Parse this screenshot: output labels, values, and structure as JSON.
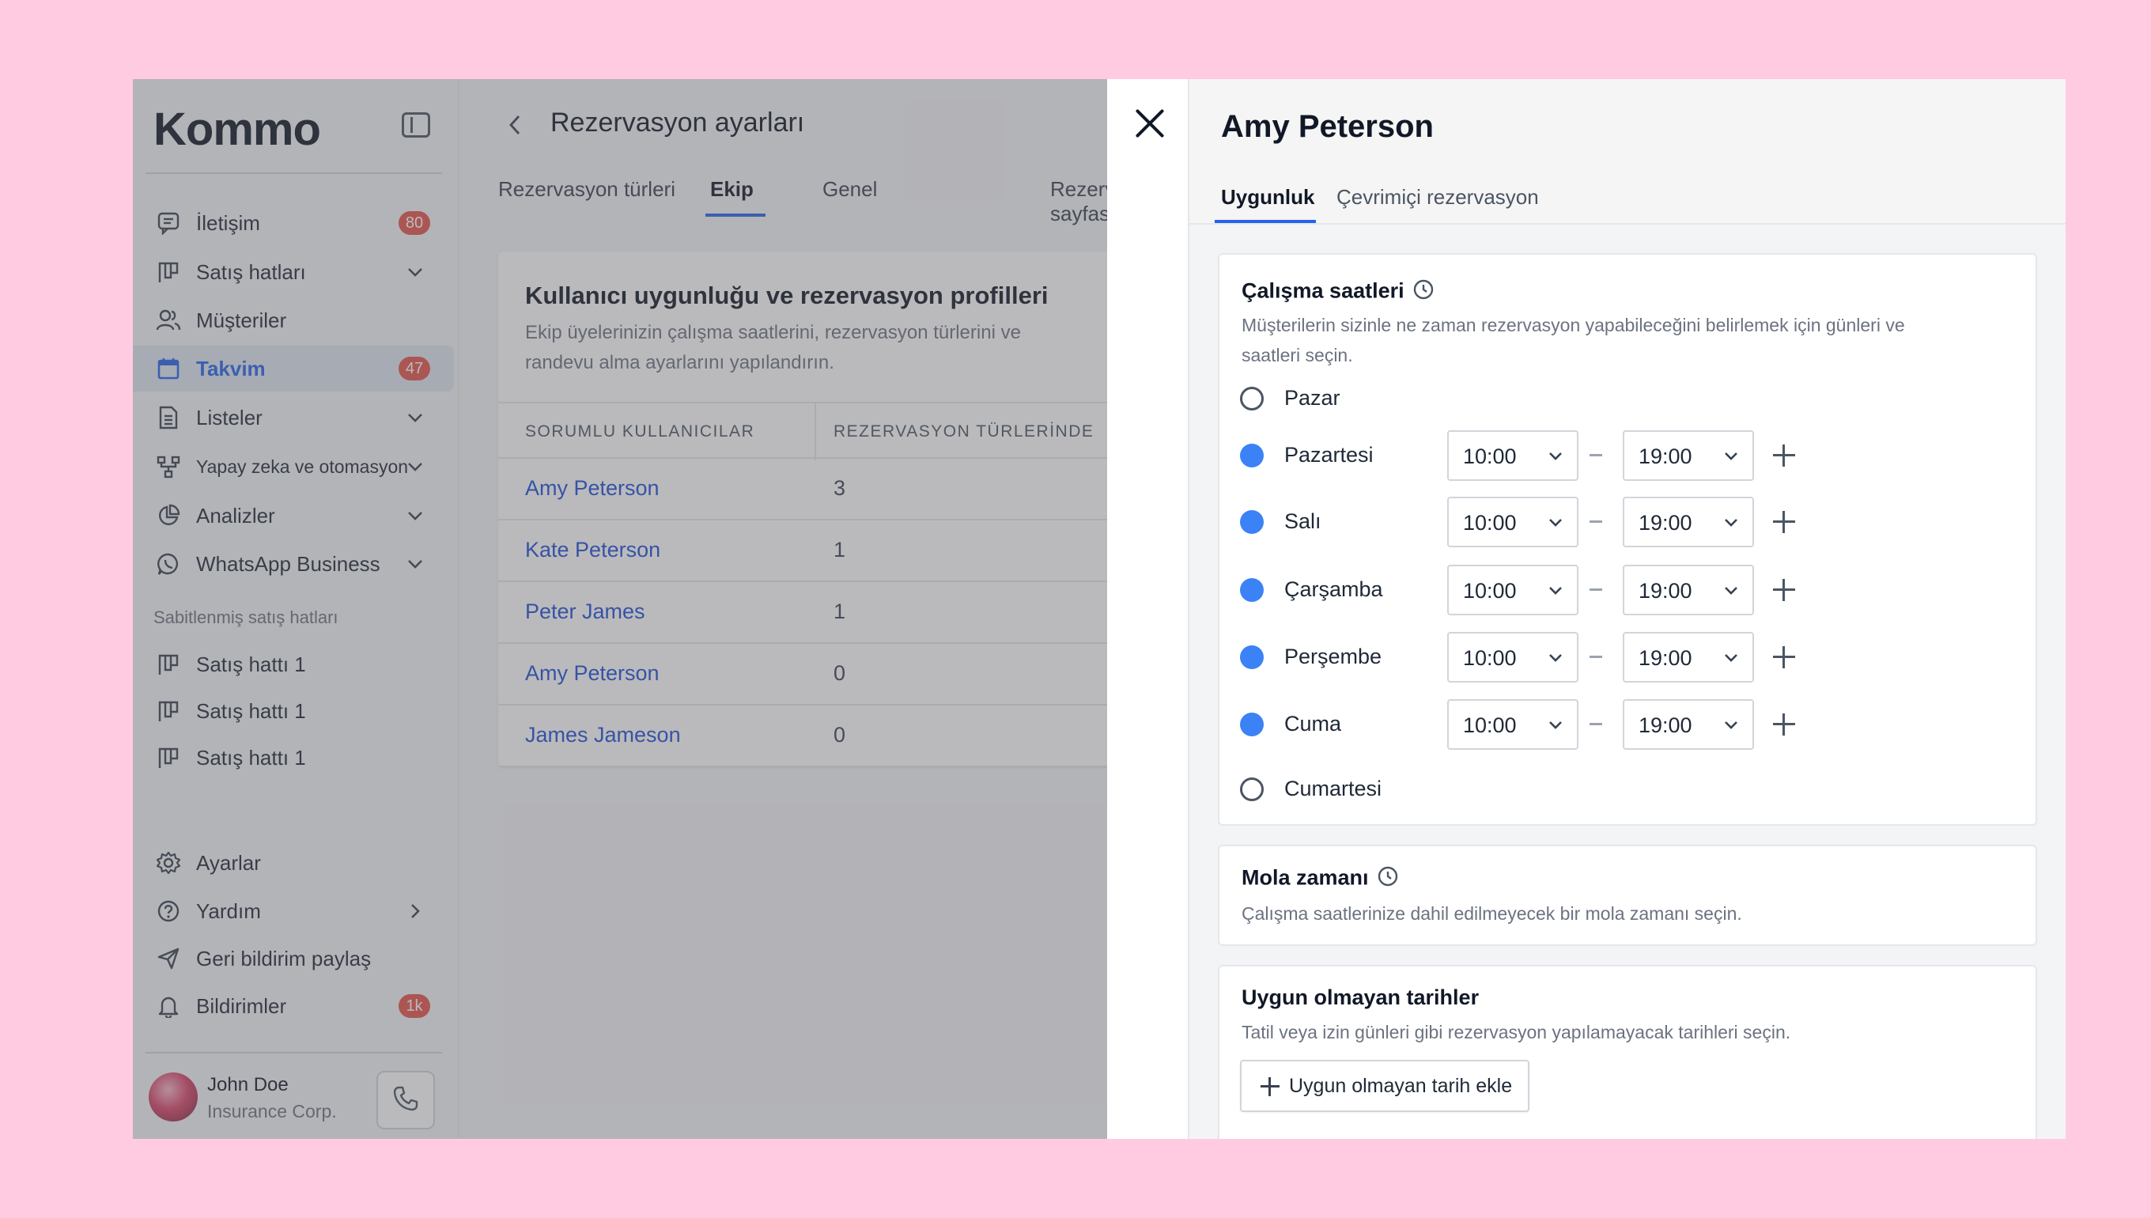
{
  "sidebar": {
    "logo": "Kommo",
    "items": [
      {
        "label": "İletişim",
        "icon": "chat-icon",
        "badge": "80"
      },
      {
        "label": "Satış hatları",
        "icon": "pipeline-icon"
      },
      {
        "label": "Müşteriler",
        "icon": "users-icon"
      },
      {
        "label": "Takvim",
        "icon": "calendar-icon",
        "badge": "47",
        "active": true
      },
      {
        "label": "Listeler",
        "icon": "list-icon"
      },
      {
        "label": "Yapay zeka ve otomasyon",
        "icon": "automation-icon"
      },
      {
        "label": "Analizler",
        "icon": "chart-icon"
      },
      {
        "label": "WhatsApp Business",
        "icon": "whatsapp-icon"
      }
    ],
    "pinned_label": "Sabitlenmiş satış hatları",
    "pinned": [
      {
        "label": "Satış hattı 1"
      },
      {
        "label": "Satış hattı 1"
      },
      {
        "label": "Satış hattı 1"
      }
    ],
    "bottom": [
      {
        "label": "Ayarlar",
        "icon": "gear-icon"
      },
      {
        "label": "Yardım",
        "icon": "help-icon"
      },
      {
        "label": "Geri bildirim paylaş",
        "icon": "send-icon"
      },
      {
        "label": "Bildirimler",
        "icon": "bell-icon",
        "badge": "1k"
      }
    ],
    "user": {
      "name": "John Doe",
      "company": "Insurance Corp."
    }
  },
  "middle": {
    "title": "Rezervasyon ayarları",
    "tabs": [
      "Rezervasyon türleri",
      "Ekip",
      "Genel",
      "Rezervasyon sayfası"
    ],
    "active_tab": "Ekip",
    "card": {
      "title": "Kullanıcı uygunluğu ve rezervasyon profilleri",
      "description": "Ekip üyelerinizin çalışma saatlerini, rezervasyon türlerini ve randevu alma ayarlarını yapılandırın.",
      "columns": [
        "SORUMLU KULLANICILAR",
        "REZERVASYON TÜRLERİNDE"
      ],
      "rows": [
        {
          "name": "Amy Peterson",
          "count": "3"
        },
        {
          "name": "Kate Peterson",
          "count": "1"
        },
        {
          "name": "Peter James",
          "count": "1"
        },
        {
          "name": "Amy Peterson",
          "count": "0"
        },
        {
          "name": "James Jameson",
          "count": "0"
        }
      ]
    }
  },
  "drawer": {
    "title": "Amy Peterson",
    "tabs": [
      "Uygunluk",
      "Çevrimiçi rezervasyon"
    ],
    "active_tab": "Uygunluk",
    "working_hours": {
      "title": "Çalışma saatleri",
      "description": "Müşterilerin sizinle ne zaman rezervasyon yapabileceğini belirlemek için günleri ve saatleri seçin.",
      "days": [
        {
          "label": "Pazar",
          "enabled": false
        },
        {
          "label": "Pazartesi",
          "enabled": true,
          "start": "10:00",
          "end": "19:00"
        },
        {
          "label": "Salı",
          "enabled": true,
          "start": "10:00",
          "end": "19:00"
        },
        {
          "label": "Çarşamba",
          "enabled": true,
          "start": "10:00",
          "end": "19:00"
        },
        {
          "label": "Perşembe",
          "enabled": true,
          "start": "10:00",
          "end": "19:00"
        },
        {
          "label": "Cuma",
          "enabled": true,
          "start": "10:00",
          "end": "19:00"
        },
        {
          "label": "Cumartesi",
          "enabled": false
        }
      ]
    },
    "break_time": {
      "title": "Mola zamanı",
      "description": "Çalışma saatlerinize dahil edilmeyecek bir mola zamanı seçin."
    },
    "unavailable_dates": {
      "title": "Uygun olmayan tarihler",
      "description": "Tatil veya izin günleri gibi rezervasyon yapılamayacak tarihleri seçin.",
      "add_button": "Uygun olmayan tarih ekle"
    }
  },
  "colors": {
    "accent": "#2563eb",
    "badge": "#e5534b",
    "radio_on": "#3b82f6",
    "background": "#fecbe0"
  }
}
